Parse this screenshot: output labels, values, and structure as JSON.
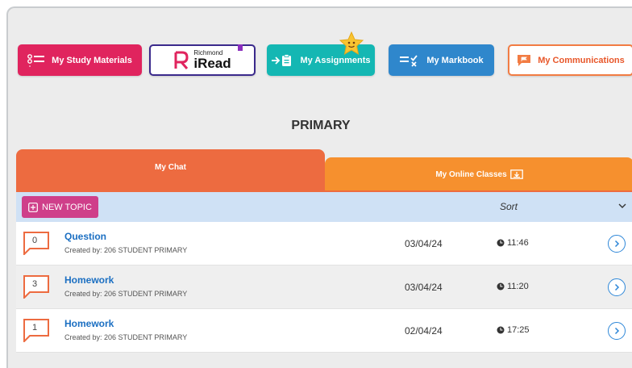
{
  "nav": {
    "study_materials": "My Study Materials",
    "iread_small": "Richmond",
    "iread_big": "iRead",
    "assignments": "My Assignments",
    "markbook": "My Markbook",
    "communications": "My Communications"
  },
  "section_title": "PRIMARY",
  "tabs": {
    "chat": "My Chat",
    "online_classes": "My Online Classes"
  },
  "list_header": {
    "new_topic": "NEW TOPIC",
    "sort": "Sort"
  },
  "topics": [
    {
      "count": "0",
      "title": "Question",
      "created_by": "Created by:  206 STUDENT PRIMARY",
      "date": "03/04/24",
      "time": "11:46"
    },
    {
      "count": "3",
      "title": "Homework",
      "created_by": "Created by:  206 STUDENT PRIMARY",
      "date": "03/04/24",
      "time": "11:20"
    },
    {
      "count": "1",
      "title": "Homework",
      "created_by": "Created by:  206 STUDENT PRIMARY",
      "date": "02/04/24",
      "time": "17:25"
    }
  ],
  "colors": {
    "study": "#e0245e",
    "assign": "#14b7b3",
    "markbook": "#2f87cc",
    "comm_accent": "#f27c43",
    "chat_tab": "#ed6b40",
    "online_tab": "#f6902e",
    "header_bar": "#cfe1f5",
    "link_blue": "#1b6fc2"
  },
  "icons": {
    "study": "list-bullets-icon",
    "assign": "clipboard-arrow-icon",
    "markbook": "checklist-x-icon",
    "comm": "flag-chat-icon",
    "star": "star-face-icon",
    "online": "screen-download-icon",
    "new_topic": "plus-square-icon",
    "sort": "chevron-down-icon",
    "bubble": "speech-bubble-icon",
    "clock": "clock-icon",
    "open": "chevron-right-circle-icon"
  }
}
